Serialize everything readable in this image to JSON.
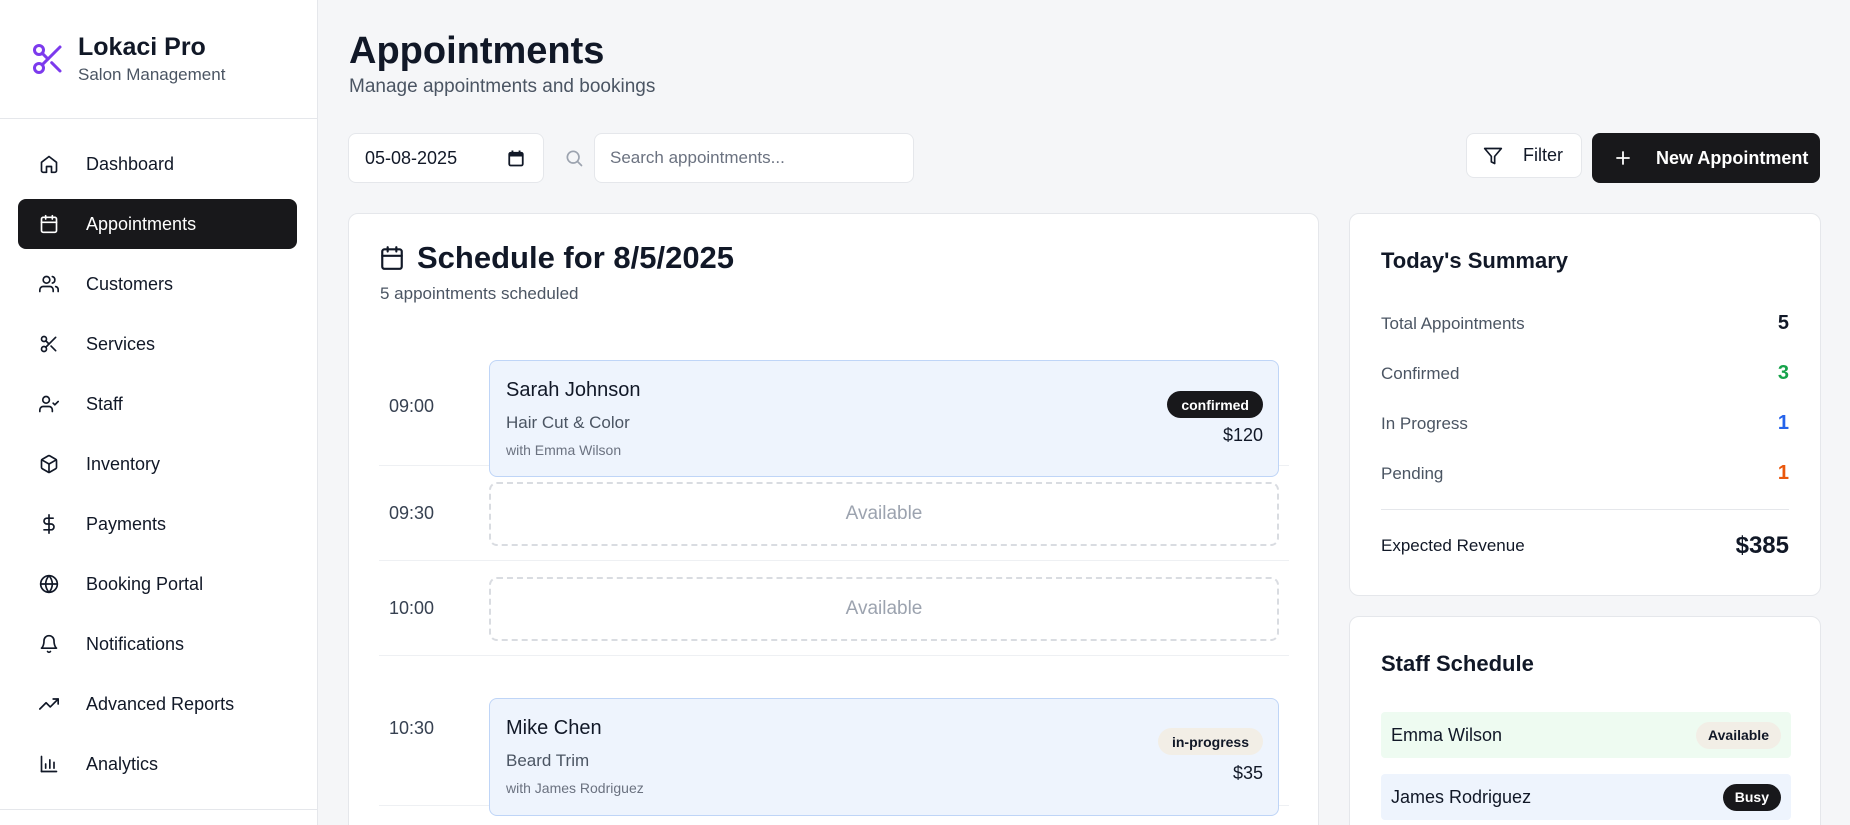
{
  "brand": {
    "name": "Lokaci Pro",
    "subtitle": "Salon Management"
  },
  "sidebar": {
    "items": [
      {
        "label": "Dashboard",
        "icon": "home-icon",
        "active": false
      },
      {
        "label": "Appointments",
        "icon": "calendar-icon",
        "active": true
      },
      {
        "label": "Customers",
        "icon": "users-icon",
        "active": false
      },
      {
        "label": "Services",
        "icon": "scissors-icon",
        "active": false
      },
      {
        "label": "Staff",
        "icon": "user-check-icon",
        "active": false
      },
      {
        "label": "Inventory",
        "icon": "package-icon",
        "active": false
      },
      {
        "label": "Payments",
        "icon": "dollar-icon",
        "active": false
      },
      {
        "label": "Booking Portal",
        "icon": "globe-icon",
        "active": false
      },
      {
        "label": "Notifications",
        "icon": "bell-icon",
        "active": false
      },
      {
        "label": "Advanced Reports",
        "icon": "trending-up-icon",
        "active": false
      },
      {
        "label": "Analytics",
        "icon": "bar-chart-icon",
        "active": false
      }
    ]
  },
  "header": {
    "title": "Appointments",
    "subtitle": "Manage appointments and bookings"
  },
  "toolbar": {
    "date_value": "05-08-2025",
    "search_placeholder": "Search appointments...",
    "filter_label": "Filter",
    "new_label": "New Appointment"
  },
  "schedule": {
    "title": "Schedule for 8/5/2025",
    "count_text": "5 appointments scheduled",
    "available_label": "Available",
    "slots": [
      {
        "time": "09:00",
        "name": "Sarah Johnson",
        "service": "Hair Cut & Color",
        "staff": "with Emma Wilson",
        "status": "confirmed",
        "price": "$120"
      },
      {
        "time": "09:30"
      },
      {
        "time": "10:00"
      },
      {
        "time": "10:30",
        "name": "Mike Chen",
        "service": "Beard Trim",
        "staff": "with James Rodriguez",
        "status": "in-progress",
        "price": "$35"
      }
    ]
  },
  "summary": {
    "title": "Today's Summary",
    "rows": [
      {
        "label": "Total Appointments",
        "value": "5",
        "color": "#111827"
      },
      {
        "label": "Confirmed",
        "value": "3",
        "color": "#16a34a"
      },
      {
        "label": "In Progress",
        "value": "1",
        "color": "#2563eb"
      },
      {
        "label": "Pending",
        "value": "1",
        "color": "#ea580c"
      }
    ],
    "revenue_label": "Expected Revenue",
    "revenue_value": "$385"
  },
  "staff_schedule": {
    "title": "Staff Schedule",
    "rows": [
      {
        "name": "Emma Wilson",
        "status": "Available",
        "row_color": "#eefbf1"
      },
      {
        "name": "James Rodriguez",
        "status": "Busy",
        "row_color": "#eef4fd"
      }
    ]
  },
  "colors": {
    "accent": "#7c3aed",
    "dark": "#18181b"
  }
}
